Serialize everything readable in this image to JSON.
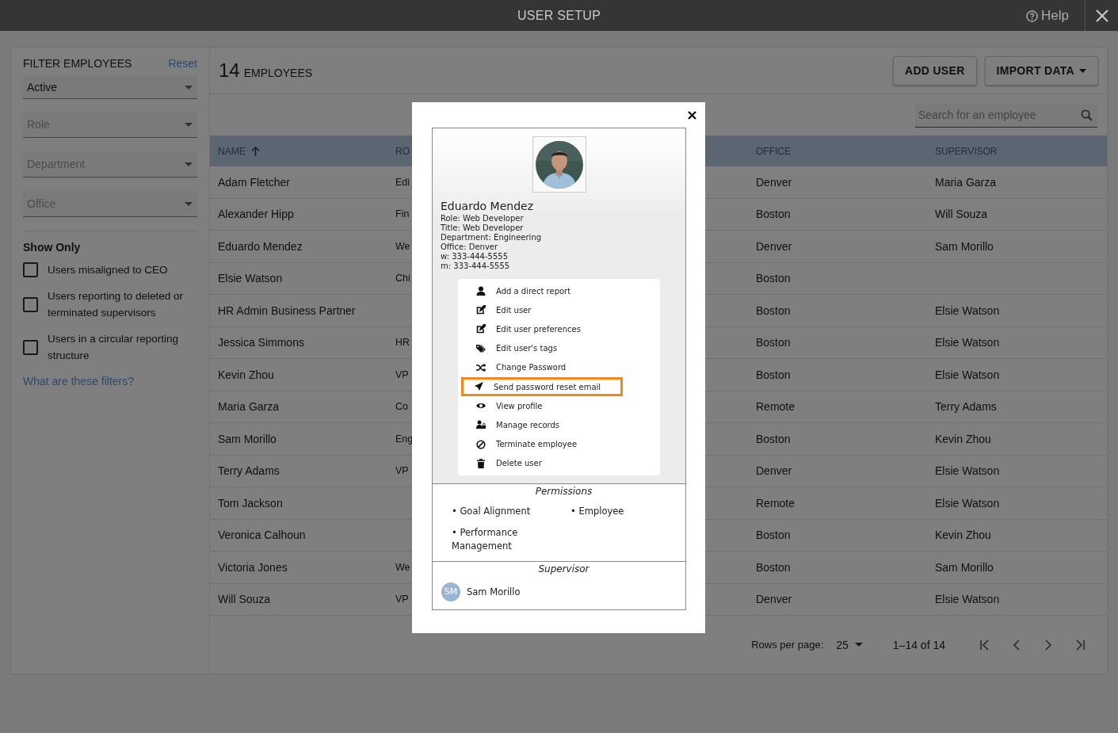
{
  "window": {
    "title": "USER SETUP",
    "help": "Help"
  },
  "filters": {
    "title": "FILTER EMPLOYEES",
    "reset": "Reset",
    "selects": [
      {
        "value": "Active"
      },
      {
        "placeholder": "Role"
      },
      {
        "placeholder": "Department"
      },
      {
        "placeholder": "Office"
      }
    ],
    "show_only_title": "Show Only",
    "checkboxes": [
      {
        "label": "Users misaligned to CEO",
        "checked": false
      },
      {
        "label": "Users reporting to deleted or terminated supervisors",
        "checked": false
      },
      {
        "label": "Users in a circular reporting structure",
        "checked": false
      }
    ],
    "help_link": "What are these filters?"
  },
  "header": {
    "count": "14",
    "count_label": "EMPLOYEES",
    "buttons": [
      {
        "label": "ADD USER",
        "dropdown": false
      },
      {
        "label": "IMPORT DATA",
        "dropdown": true
      }
    ],
    "search": {
      "placeholder": "Search for an employee"
    }
  },
  "table": {
    "columns": [
      {
        "label": "NAME",
        "sorted": true
      },
      {
        "label": "RO"
      },
      {
        "label": "OFFICE"
      },
      {
        "label": "SUPERVISOR"
      }
    ],
    "rows": [
      [
        "Adam Fletcher",
        "Edi",
        "Denver",
        "Maria Garza"
      ],
      [
        "Alexander Hipp",
        "Fin",
        "Boston",
        "Will Souza"
      ],
      [
        "Eduardo Mendez",
        "We",
        "Denver",
        "Sam Morillo"
      ],
      [
        "Elsie Watson",
        "Chi",
        "Boston",
        ""
      ],
      [
        "HR Admin Business Partner",
        "",
        "Boston",
        "Elsie Watson"
      ],
      [
        "Jessica Simmons",
        "HR",
        "Boston",
        "Elsie Watson"
      ],
      [
        "Kevin Zhou",
        "VP",
        "Boston",
        "Elsie Watson"
      ],
      [
        "Maria Garza",
        "Co",
        "Remote",
        "Terry Adams"
      ],
      [
        "Sam Morillo",
        "Eng",
        "Boston",
        "Kevin Zhou"
      ],
      [
        "Terry Adams",
        "VP",
        "Denver",
        "Elsie Watson"
      ],
      [
        "Tom Jackson",
        "",
        "Remote",
        "Elsie Watson"
      ],
      [
        "Veronica Calhoun",
        "",
        "Boston",
        "Kevin Zhou"
      ],
      [
        "Victoria Jones",
        "We",
        "Boston",
        "Sam Morillo"
      ],
      [
        "Will Souza",
        "VP",
        "Denver",
        "Elsie Watson"
      ]
    ]
  },
  "pagination": {
    "rows_label": "Rows per page:",
    "rows_value": "25",
    "range": "1–14 of 14"
  },
  "modal": {
    "name": "Eduardo Mendez",
    "details": [
      "Role: Web Developer",
      "Title: Web Developer",
      "Department: Engineering",
      "Office: Denver",
      "w: 333-444-5555",
      "m: 333-444-5555"
    ],
    "menu": [
      {
        "label": "Add a direct report",
        "highlighted": false
      },
      {
        "label": "Edit user",
        "highlighted": false
      },
      {
        "label": "Edit user preferences",
        "highlighted": false
      },
      {
        "label": "Edit user's tags",
        "highlighted": false
      },
      {
        "label": "Change Password",
        "highlighted": false
      },
      {
        "label": "Send password reset email",
        "highlighted": true
      },
      {
        "label": "View profile",
        "highlighted": false
      },
      {
        "label": "Manage records",
        "highlighted": false
      },
      {
        "label": "Terminate employee",
        "highlighted": false
      },
      {
        "label": "Delete user",
        "highlighted": false
      }
    ],
    "permissions_title": "Permissions",
    "permissions": [
      "• Goal Alignment",
      "• Employee",
      "• Performance Management"
    ],
    "supervisor_title": "Supervisor",
    "supervisor": {
      "initials": "SM",
      "name": "Sam Morillo"
    }
  }
}
